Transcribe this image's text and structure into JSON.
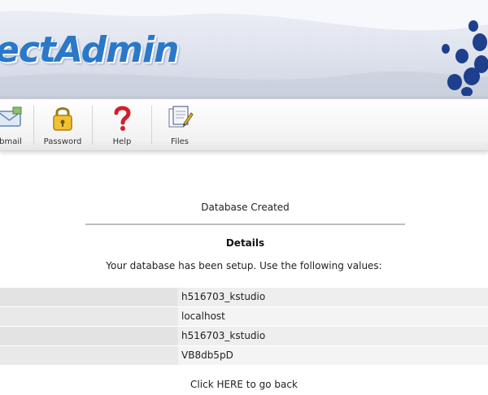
{
  "banner": {
    "logo_text": "ectAdmin"
  },
  "toolbar": {
    "items": [
      {
        "label": "bmail",
        "icon": "webmail-icon"
      },
      {
        "label": "Password",
        "icon": "padlock-icon"
      },
      {
        "label": "Help",
        "icon": "question-mark-icon"
      },
      {
        "label": "Files",
        "icon": "files-icon"
      }
    ]
  },
  "content": {
    "status_title": "Database Created",
    "details_heading": "Details",
    "details_description": "Your database has been setup. Use the following values:",
    "values": [
      "h516703_kstudio",
      "localhost",
      "h516703_kstudio",
      "VB8db5pD"
    ],
    "back_link": "Click HERE to go back"
  },
  "colors": {
    "logo_blue": "#2a78c8",
    "dots_navy": "#1d3f8c"
  }
}
